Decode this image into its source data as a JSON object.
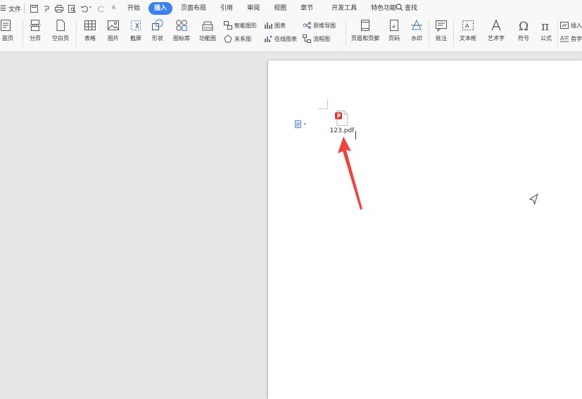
{
  "menubar": {
    "file_label": "文件",
    "tabs": [
      {
        "label": "开始",
        "active": false
      },
      {
        "label": "插入",
        "active": true
      },
      {
        "label": "页面布局",
        "active": false
      },
      {
        "label": "引用",
        "active": false
      },
      {
        "label": "审阅",
        "active": false
      },
      {
        "label": "视图",
        "active": false
      },
      {
        "label": "章节",
        "active": false
      },
      {
        "label": "开发工具",
        "active": false
      },
      {
        "label": "特色功能",
        "active": false
      }
    ],
    "search_label": "查找"
  },
  "ribbon": {
    "cover_page": "面页",
    "page_break": "分页",
    "blank_page": "空白页",
    "table": "表格",
    "picture": "图片",
    "screenshot": "截屏",
    "shapes": "形状",
    "icon_library": "图标库",
    "function_chart": "功能图",
    "smart_graphic": "智能图形",
    "chart": "图表",
    "mind_map": "思维导图",
    "relation_chart": "关系图",
    "online_chart": "在线图表",
    "flow_chart": "流程图",
    "header_footer": "页眉和页脚",
    "page_number": "页码",
    "watermark": "水印",
    "comment": "批注",
    "text_box": "文本框",
    "word_art": "艺术字",
    "symbol": "符号",
    "formula": "公式",
    "insert_object": "插入",
    "drop_cap": "首字"
  },
  "document": {
    "attachment_name": "123.pdf"
  },
  "colors": {
    "accent": "#3c7ff3",
    "arrow": "#f0433b",
    "pdf_badge": "#d8372f"
  }
}
